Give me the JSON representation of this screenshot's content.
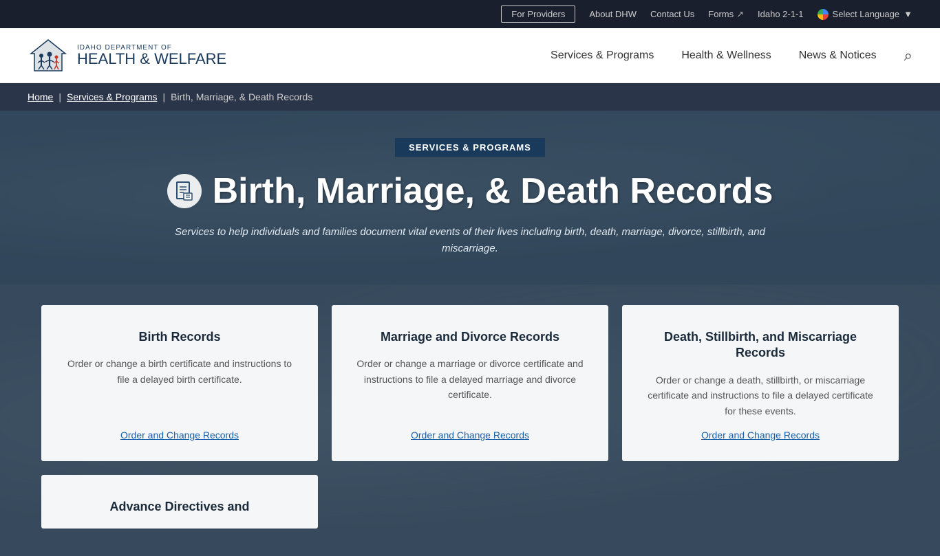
{
  "topbar": {
    "for_providers": "For Providers",
    "about": "About DHW",
    "contact": "Contact Us",
    "forms": "Forms",
    "idaho211": "Idaho 2-1-1",
    "select_language": "Select Language"
  },
  "header": {
    "logo_top": "IDAHO DEPARTMENT OF",
    "logo_main": "HEALTH",
    "logo_amp": " & ",
    "logo_end": "WELFARE",
    "nav_services": "Services & Programs",
    "nav_health": "Health & Wellness",
    "nav_news": "News & Notices"
  },
  "breadcrumb": {
    "home": "Home",
    "services": "Services & Programs",
    "current": "Birth, Marriage, & Death Records"
  },
  "hero": {
    "category": "SERVICES & PROGRAMS",
    "title": "Birth, Marriage, & Death Records",
    "subtitle": "Services to help individuals and families document vital events of their lives including birth, death, marriage, divorce, stillbirth, and miscarriage."
  },
  "cards": [
    {
      "title": "Birth Records",
      "desc": "Order or change a birth certificate and instructions to file a delayed birth certificate.",
      "link": "Order and Change Records"
    },
    {
      "title": "Marriage and Divorce Records",
      "desc": "Order or change a marriage or divorce certificate and instructions to file a delayed marriage and divorce certificate.",
      "link": "Order and Change Records"
    },
    {
      "title": "Death, Stillbirth, and Miscarriage Records",
      "desc": "Order or change a death, stillbirth, or miscarriage certificate and instructions to file a delayed certificate for these events.",
      "link": "Order and Change Records"
    }
  ],
  "partial_card": {
    "title": "Advance Directives and"
  }
}
